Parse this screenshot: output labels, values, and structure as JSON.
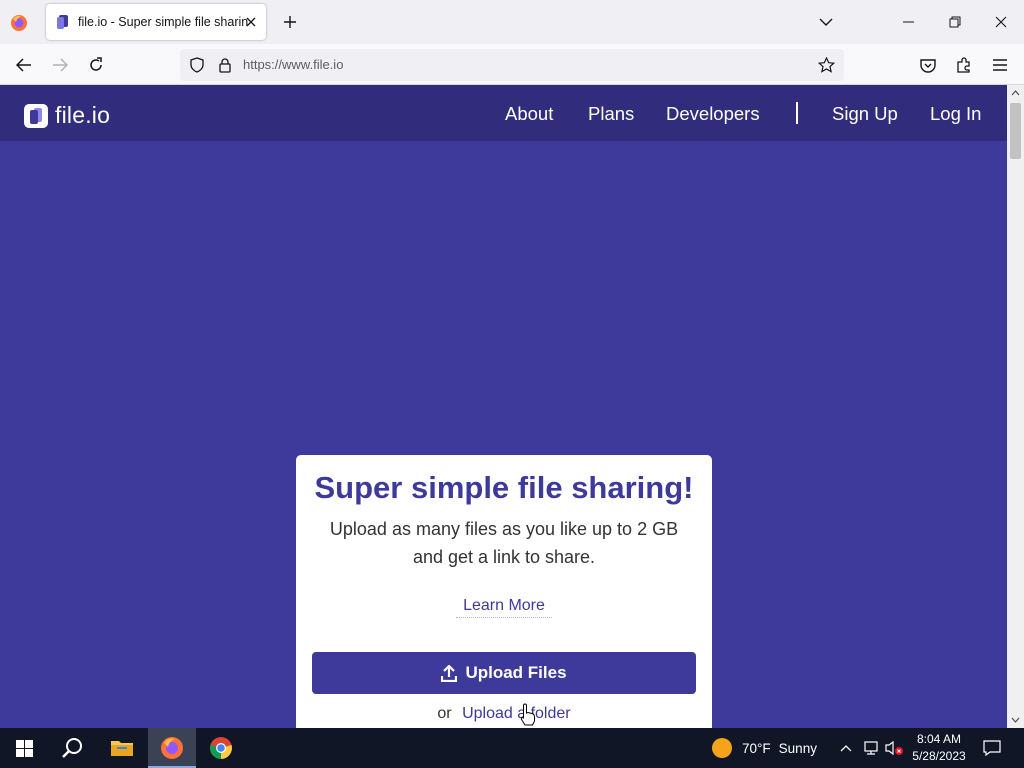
{
  "browser": {
    "tab_title": "file.io - Super simple file sharing",
    "url": "https://www.file.io"
  },
  "site": {
    "logo_text": "file.io",
    "nav": {
      "about": "About",
      "plans": "Plans",
      "developers": "Developers",
      "sign_up": "Sign Up",
      "log_in": "Log In"
    },
    "hero": {
      "title": "Super simple file sharing!",
      "description_line1": "Upload as many files as you like up to 2 GB",
      "description_line2": "and get a link to share.",
      "learn_more": "Learn More",
      "upload_files": "Upload Files",
      "or_text": "or",
      "upload_folder": "Upload a folder"
    }
  },
  "taskbar": {
    "weather_temp": "70°F",
    "weather_desc": "Sunny",
    "time": "8:04 AM",
    "date": "5/28/2023"
  },
  "colors": {
    "brand_purple": "#3e3a9c",
    "header_purple": "#322c7c",
    "taskbar_bg": "#101626"
  },
  "icons": [
    "firefox-icon",
    "close-icon",
    "plus-icon",
    "chevron-down-icon",
    "back-icon",
    "forward-icon",
    "reload-icon",
    "shield-icon",
    "lock-icon",
    "star-icon",
    "pocket-icon",
    "extensions-icon",
    "menu-icon",
    "upload-icon",
    "windows-start-icon",
    "search-icon",
    "file-explorer-icon",
    "chrome-icon",
    "network-icon",
    "volume-muted-icon",
    "notification-icon"
  ]
}
